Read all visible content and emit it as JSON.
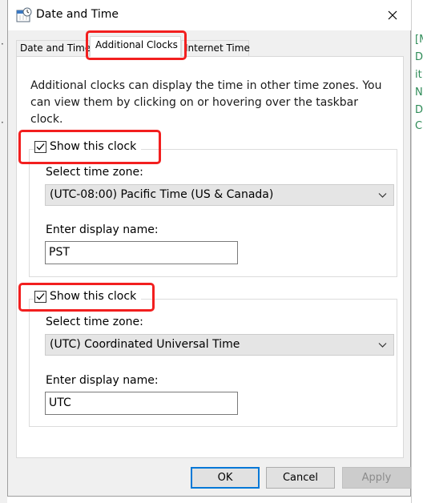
{
  "window": {
    "title": "Date and Time"
  },
  "tabs": [
    {
      "label": "Date and Time"
    },
    {
      "label": "Additional Clocks"
    },
    {
      "label": "Internet Time"
    }
  ],
  "description": "Additional clocks can display the time in other time zones. You can view them by clicking on or hovering over the taskbar clock.",
  "clocks": [
    {
      "show_label": "Show this clock",
      "checked": true,
      "tz_label": "Select time zone:",
      "tz_value": "(UTC-08:00) Pacific Time (US & Canada)",
      "name_label": "Enter display name:",
      "name_value": "PST"
    },
    {
      "show_label": "Show this clock",
      "checked": true,
      "tz_label": "Select time zone:",
      "tz_value": "(UTC) Coordinated Universal Time",
      "name_label": "Enter display name:",
      "name_value": "UTC"
    }
  ],
  "buttons": {
    "ok": "OK",
    "cancel": "Cancel",
    "apply": "Apply"
  },
  "background_fragments": [
    "[M",
    "D",
    "it",
    "N",
    "D",
    "C"
  ],
  "colors": {
    "highlight": "#f21f1f",
    "focus": "#0078d7"
  }
}
